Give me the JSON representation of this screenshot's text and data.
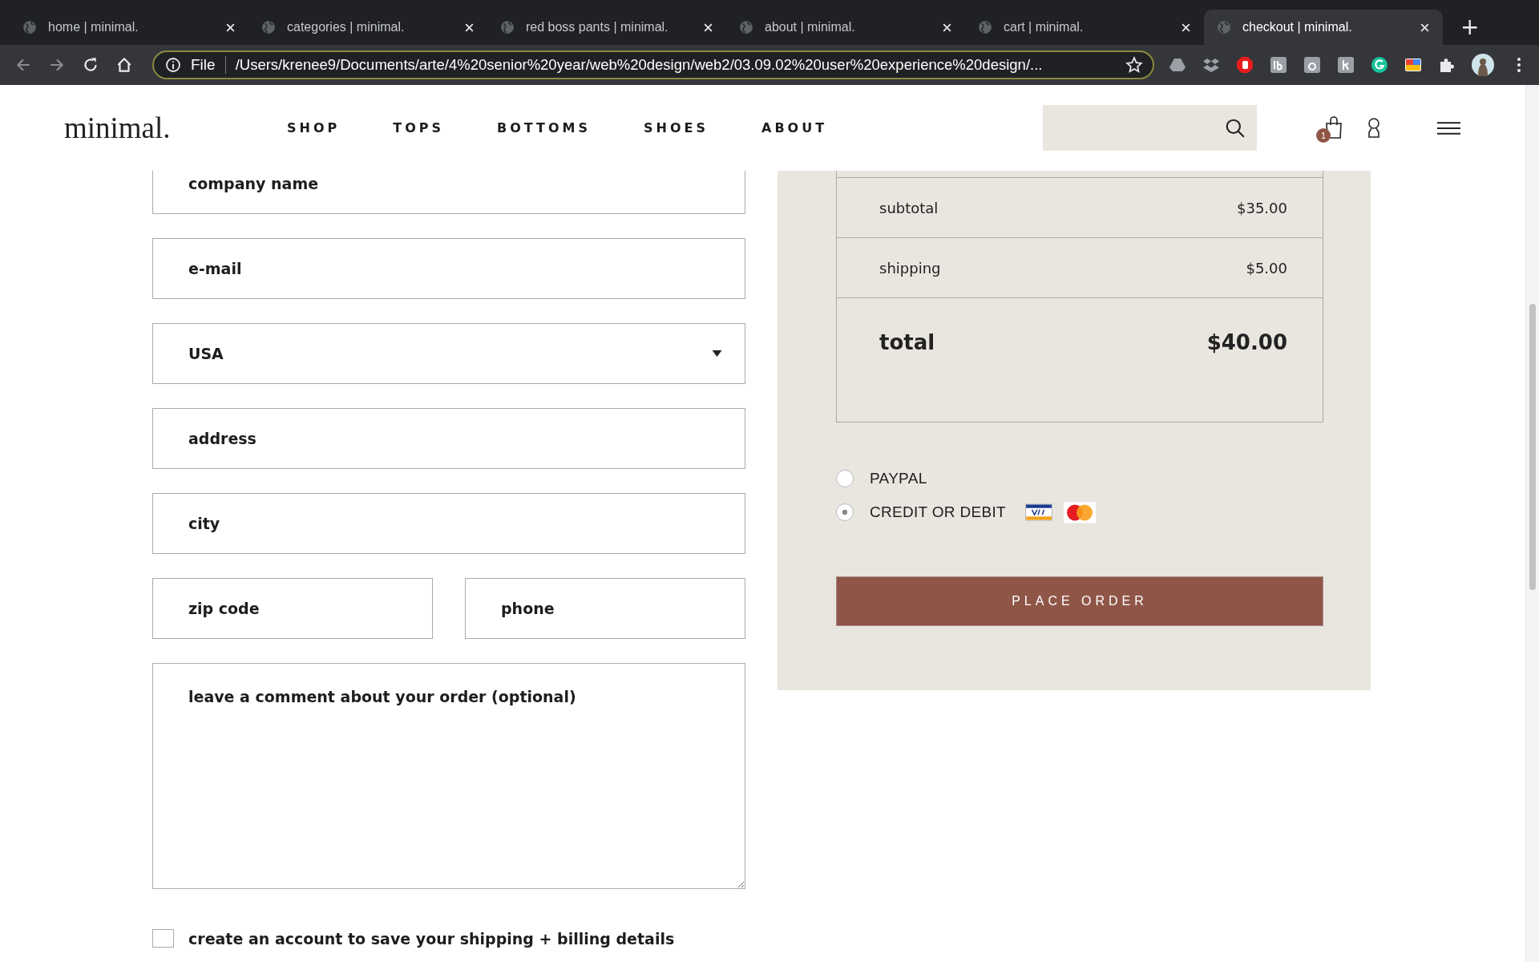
{
  "browser": {
    "tabs": [
      {
        "title": "home | minimal.",
        "selected": false
      },
      {
        "title": "categories | minimal.",
        "selected": false
      },
      {
        "title": "red boss pants | minimal.",
        "selected": false
      },
      {
        "title": "about | minimal.",
        "selected": false
      },
      {
        "title": "cart | minimal.",
        "selected": false
      },
      {
        "title": "checkout | minimal.",
        "selected": true
      }
    ],
    "new_tab": "+",
    "address": {
      "scheme": "File",
      "url": "/Users/krenee9/Documents/arte/4%20senior%20year/web%20design/web2/03.09.02%20user%20experience%20design/..."
    }
  },
  "header": {
    "logo": "minimal.",
    "nav": [
      "SHOP",
      "TOPS",
      "BOTTOMS",
      "SHOES",
      "ABOUT"
    ],
    "cart_count": "1"
  },
  "form": {
    "rows": [
      [
        {
          "kind": "text",
          "placeholder": "company name"
        }
      ],
      [
        {
          "kind": "text",
          "placeholder": "e-mail"
        }
      ],
      [
        {
          "kind": "select",
          "value": "USA"
        }
      ],
      [
        {
          "kind": "text",
          "placeholder": "address"
        }
      ],
      [
        {
          "kind": "text",
          "placeholder": "city"
        }
      ],
      [
        {
          "kind": "text",
          "placeholder": "zip code"
        },
        {
          "kind": "text",
          "placeholder": "phone"
        }
      ],
      [
        {
          "kind": "textarea",
          "placeholder": "leave a comment about your order (optional)"
        }
      ]
    ],
    "create_account": {
      "label": "create an account to save your shipping + billing details",
      "checked": false
    }
  },
  "summary": {
    "rows": [
      {
        "kind": "line",
        "label": "subtotal",
        "amount": "$35.00"
      },
      {
        "kind": "line",
        "label": "shipping",
        "amount": "$5.00"
      },
      {
        "kind": "total",
        "label": "total",
        "amount": "$40.00"
      }
    ],
    "payment_methods": [
      {
        "label": "PAYPAL",
        "selected": false,
        "kind": "plain"
      },
      {
        "label": "CREDIT OR DEBIT",
        "selected": true,
        "kind": "cards"
      }
    ],
    "button": "PLACE ORDER"
  }
}
